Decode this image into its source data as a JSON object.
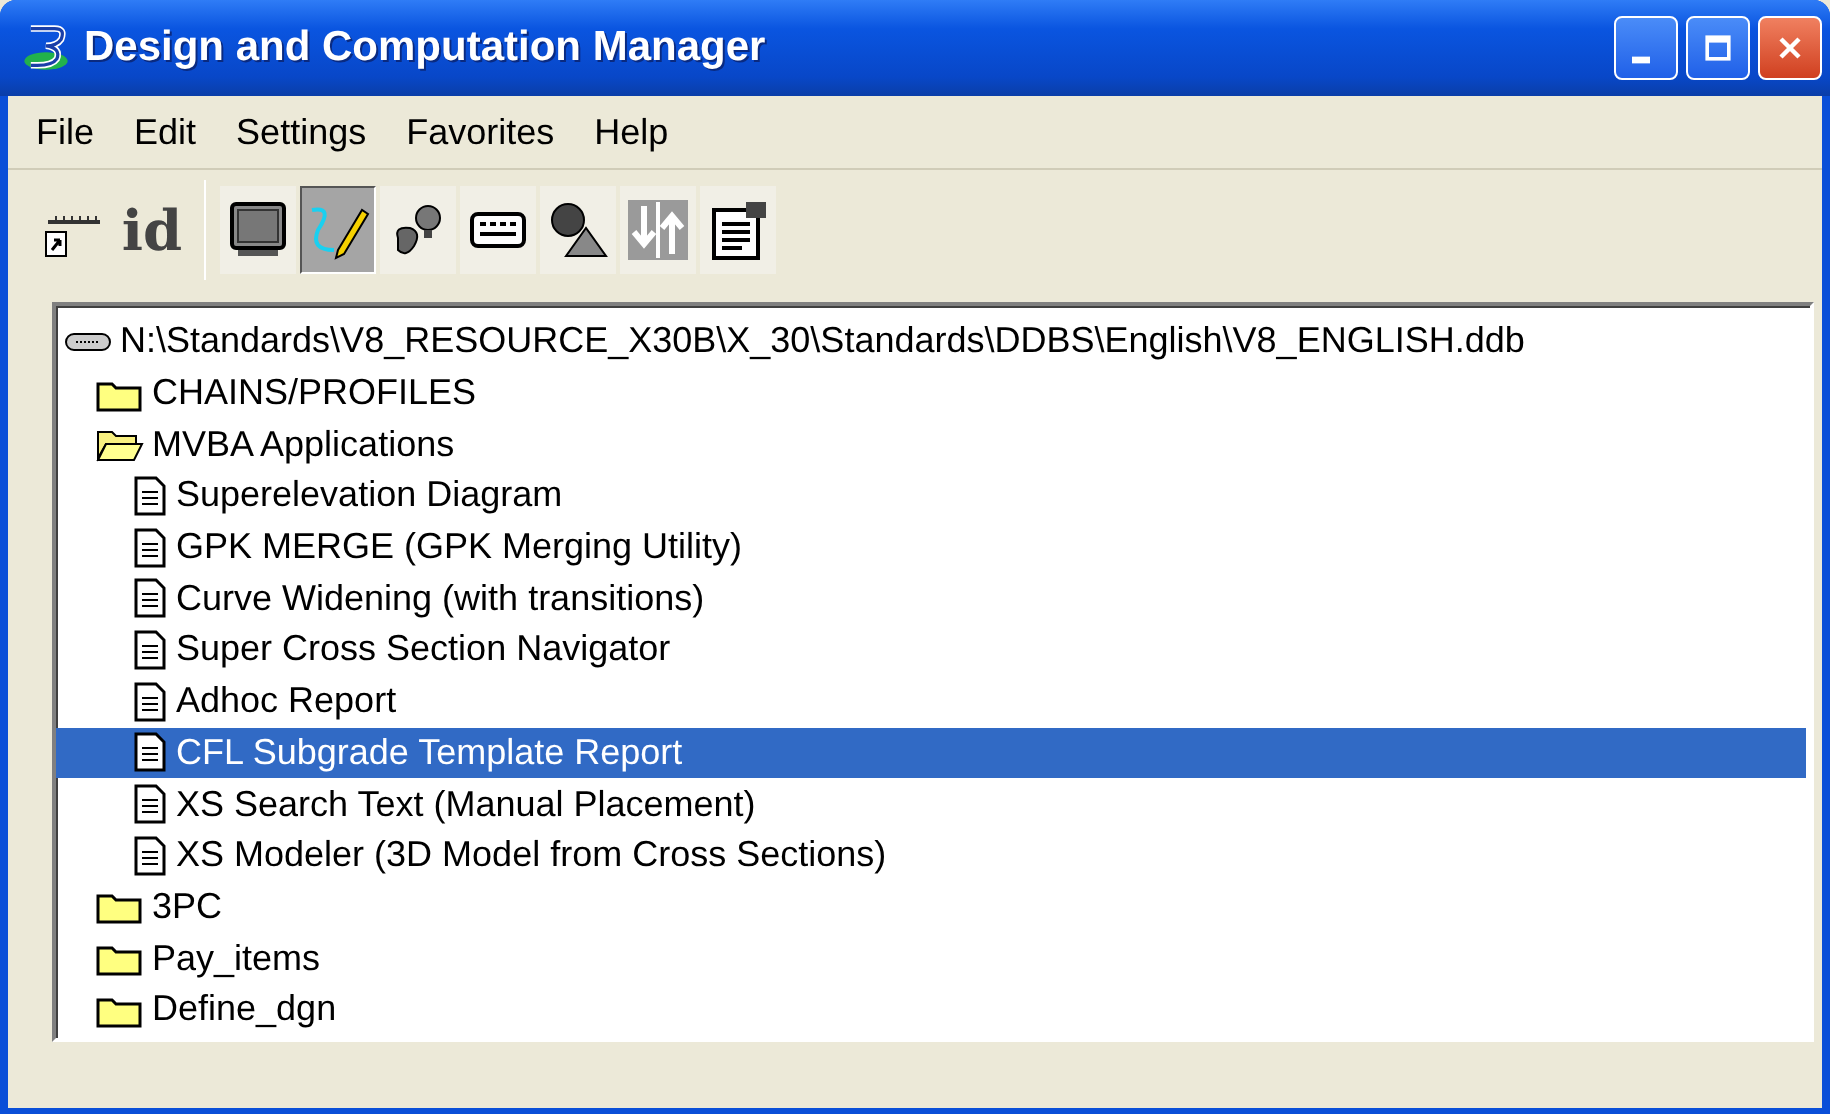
{
  "window": {
    "title": "Design and Computation Manager"
  },
  "menu": [
    {
      "label": "File"
    },
    {
      "label": "Edit"
    },
    {
      "label": "Settings"
    },
    {
      "label": "Favorites"
    },
    {
      "label": "Help"
    }
  ],
  "toolbar": [
    {
      "kind": "place",
      "pressed": false
    },
    {
      "kind": "text",
      "label": "id",
      "pressed": false
    },
    {
      "kind": "monitor",
      "pressed": false
    },
    {
      "kind": "pen",
      "pressed": true
    },
    {
      "kind": "bulb",
      "pressed": false
    },
    {
      "kind": "keypad",
      "pressed": false
    },
    {
      "kind": "shapes",
      "pressed": false
    },
    {
      "kind": "arrows",
      "pressed": false
    },
    {
      "kind": "clipboard",
      "pressed": false
    }
  ],
  "tree": {
    "kind": "drive",
    "label": "N:\\Standards\\V8_RESOURCE_X30B\\X_30\\Standards\\DDBS\\English\\V8_ENGLISH.ddb",
    "selected": false,
    "children": [
      {
        "kind": "folder",
        "label": "CHAINS/PROFILES",
        "selected": false,
        "expanded": false
      },
      {
        "kind": "folder",
        "label": "MVBA Applications",
        "selected": false,
        "expanded": true,
        "children": [
          {
            "kind": "document",
            "label": "Superelevation Diagram",
            "selected": false
          },
          {
            "kind": "document",
            "label": "GPK MERGE (GPK Merging Utility)",
            "selected": false
          },
          {
            "kind": "document",
            "label": "Curve Widening (with transitions)",
            "selected": false
          },
          {
            "kind": "document",
            "label": "Super Cross Section Navigator",
            "selected": false
          },
          {
            "kind": "document",
            "label": "Adhoc Report",
            "selected": false
          },
          {
            "kind": "document",
            "label": "CFL Subgrade Template Report",
            "selected": true
          },
          {
            "kind": "document",
            "label": "XS Search Text (Manual Placement)",
            "selected": false
          },
          {
            "kind": "document",
            "label": "XS Modeler (3D Model from Cross Sections)",
            "selected": false
          }
        ]
      },
      {
        "kind": "folder",
        "label": "3PC",
        "selected": false,
        "expanded": false
      },
      {
        "kind": "folder",
        "label": "Pay_items",
        "selected": false,
        "expanded": false
      },
      {
        "kind": "folder",
        "label": "Define_dgn",
        "selected": false,
        "expanded": false
      }
    ]
  }
}
